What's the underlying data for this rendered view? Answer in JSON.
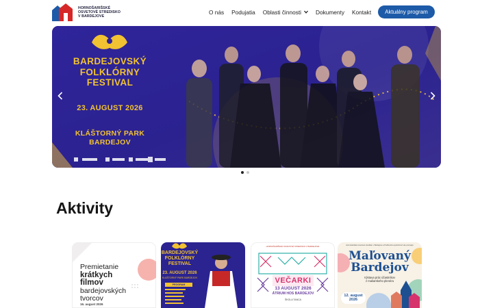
{
  "header": {
    "logo_lines": [
      "HORNOŠARIŠSKÉ",
      "OSVETOVÉ STREDISKO",
      "V BARDEJOVE"
    ],
    "nav": [
      {
        "label": "O nás"
      },
      {
        "label": "Podujatia"
      },
      {
        "label": "Oblasti činnosti"
      },
      {
        "label": "Dokumenty"
      },
      {
        "label": "Kontakt"
      }
    ],
    "cta_label": "Aktuálny program"
  },
  "hero": {
    "title_lines": [
      "BARDEJOVSKÝ",
      "FOLKLÓRNY",
      "FESTIVAL"
    ],
    "date": "23. AUGUST 2026",
    "place_lines": [
      "KLÁŠTORNÝ PARK",
      "BARDEJOV"
    ],
    "prev_icon": "chevron-left-icon",
    "next_icon": "chevron-right-icon",
    "dots_count": 2,
    "active_dot": 0
  },
  "section": {
    "title": "Aktivity"
  },
  "cards": [
    {
      "title_line1": "Premietanie",
      "title_bold": "krátkych filmov",
      "title_line3": "bardejovských",
      "title_line4": "tvorcov",
      "date": "16. august 2026"
    },
    {
      "title_lines": [
        "BARDEJOVSKÝ",
        "FOLKLÓRNY",
        "FESTIVAL"
      ],
      "date": "23. AUGUST 2026",
      "place": "KLÁŠTORNÝ PARK BARDEJOV",
      "program_label": "PROGRAM"
    },
    {
      "top_text": "HORNOŠARIŠSKÉ OSVETOVÉ STREDISKO V BARDEJOVE",
      "title": "VEČARKI",
      "date": "13 AUGUST 2026",
      "place": "ÁTRIUM HOS BARDEJOV",
      "sub": "ŠKOLA TANCA"
    },
    {
      "top_text": "Hornošarišské osvetové stredisko v Bardejove a Podbrezina spoločnosť vás pozývajú",
      "title_lines": [
        "Maľovaný",
        "Bardejov"
      ],
      "sub_lines": [
        "Výstava prác účastníkov",
        "z maliarskeho plenéra"
      ],
      "date_lines": [
        "12. august",
        "2026"
      ]
    }
  ],
  "colors": {
    "brand_blue": "#1d5aa8",
    "hero_bg": "#2a1f8c",
    "festival_gold": "#f1c232",
    "dot_active": "#222222",
    "dot_inactive": "#c8c8c8"
  }
}
